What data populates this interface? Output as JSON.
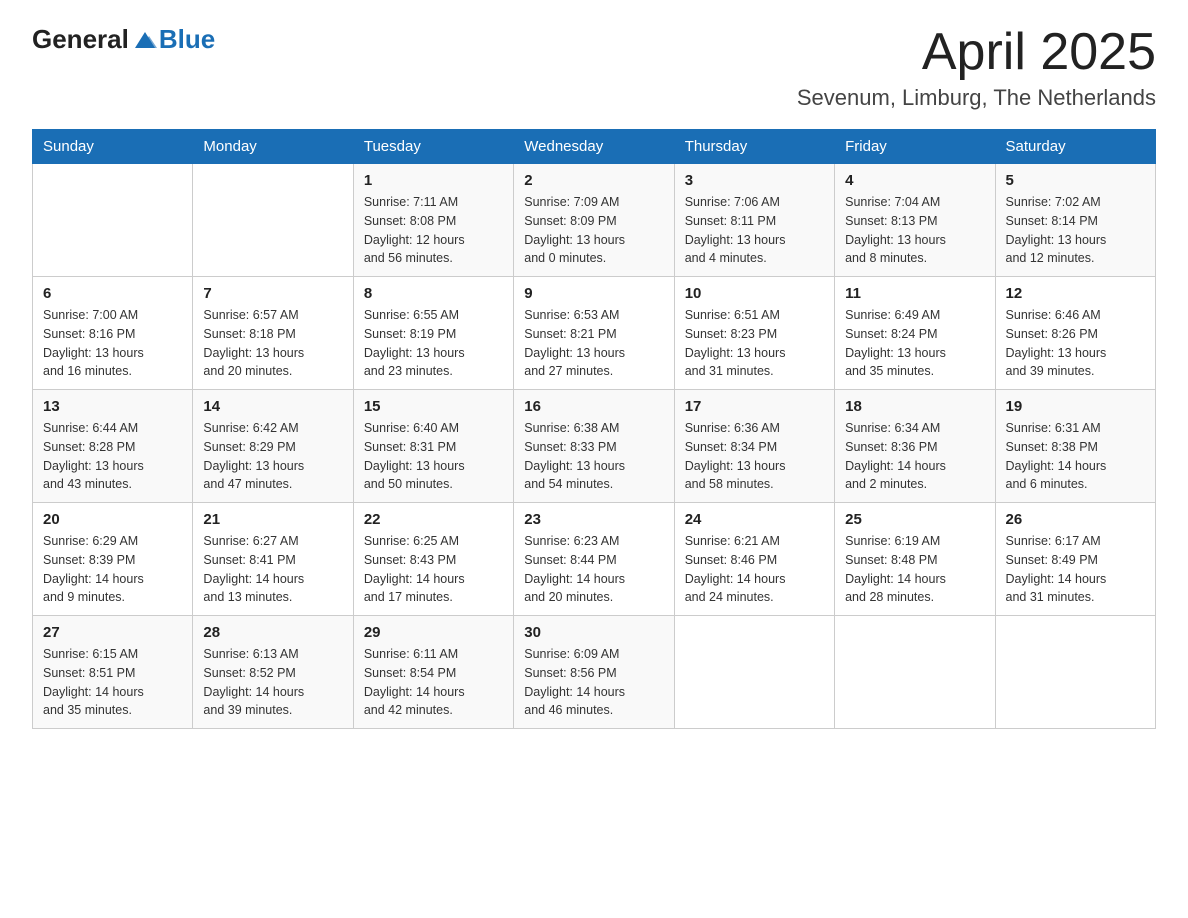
{
  "header": {
    "logo_general": "General",
    "logo_blue": "Blue",
    "title": "April 2025",
    "subtitle": "Sevenum, Limburg, The Netherlands"
  },
  "calendar": {
    "days_of_week": [
      "Sunday",
      "Monday",
      "Tuesday",
      "Wednesday",
      "Thursday",
      "Friday",
      "Saturday"
    ],
    "weeks": [
      [
        {
          "day": "",
          "info": ""
        },
        {
          "day": "",
          "info": ""
        },
        {
          "day": "1",
          "info": "Sunrise: 7:11 AM\nSunset: 8:08 PM\nDaylight: 12 hours\nand 56 minutes."
        },
        {
          "day": "2",
          "info": "Sunrise: 7:09 AM\nSunset: 8:09 PM\nDaylight: 13 hours\nand 0 minutes."
        },
        {
          "day": "3",
          "info": "Sunrise: 7:06 AM\nSunset: 8:11 PM\nDaylight: 13 hours\nand 4 minutes."
        },
        {
          "day": "4",
          "info": "Sunrise: 7:04 AM\nSunset: 8:13 PM\nDaylight: 13 hours\nand 8 minutes."
        },
        {
          "day": "5",
          "info": "Sunrise: 7:02 AM\nSunset: 8:14 PM\nDaylight: 13 hours\nand 12 minutes."
        }
      ],
      [
        {
          "day": "6",
          "info": "Sunrise: 7:00 AM\nSunset: 8:16 PM\nDaylight: 13 hours\nand 16 minutes."
        },
        {
          "day": "7",
          "info": "Sunrise: 6:57 AM\nSunset: 8:18 PM\nDaylight: 13 hours\nand 20 minutes."
        },
        {
          "day": "8",
          "info": "Sunrise: 6:55 AM\nSunset: 8:19 PM\nDaylight: 13 hours\nand 23 minutes."
        },
        {
          "day": "9",
          "info": "Sunrise: 6:53 AM\nSunset: 8:21 PM\nDaylight: 13 hours\nand 27 minutes."
        },
        {
          "day": "10",
          "info": "Sunrise: 6:51 AM\nSunset: 8:23 PM\nDaylight: 13 hours\nand 31 minutes."
        },
        {
          "day": "11",
          "info": "Sunrise: 6:49 AM\nSunset: 8:24 PM\nDaylight: 13 hours\nand 35 minutes."
        },
        {
          "day": "12",
          "info": "Sunrise: 6:46 AM\nSunset: 8:26 PM\nDaylight: 13 hours\nand 39 minutes."
        }
      ],
      [
        {
          "day": "13",
          "info": "Sunrise: 6:44 AM\nSunset: 8:28 PM\nDaylight: 13 hours\nand 43 minutes."
        },
        {
          "day": "14",
          "info": "Sunrise: 6:42 AM\nSunset: 8:29 PM\nDaylight: 13 hours\nand 47 minutes."
        },
        {
          "day": "15",
          "info": "Sunrise: 6:40 AM\nSunset: 8:31 PM\nDaylight: 13 hours\nand 50 minutes."
        },
        {
          "day": "16",
          "info": "Sunrise: 6:38 AM\nSunset: 8:33 PM\nDaylight: 13 hours\nand 54 minutes."
        },
        {
          "day": "17",
          "info": "Sunrise: 6:36 AM\nSunset: 8:34 PM\nDaylight: 13 hours\nand 58 minutes."
        },
        {
          "day": "18",
          "info": "Sunrise: 6:34 AM\nSunset: 8:36 PM\nDaylight: 14 hours\nand 2 minutes."
        },
        {
          "day": "19",
          "info": "Sunrise: 6:31 AM\nSunset: 8:38 PM\nDaylight: 14 hours\nand 6 minutes."
        }
      ],
      [
        {
          "day": "20",
          "info": "Sunrise: 6:29 AM\nSunset: 8:39 PM\nDaylight: 14 hours\nand 9 minutes."
        },
        {
          "day": "21",
          "info": "Sunrise: 6:27 AM\nSunset: 8:41 PM\nDaylight: 14 hours\nand 13 minutes."
        },
        {
          "day": "22",
          "info": "Sunrise: 6:25 AM\nSunset: 8:43 PM\nDaylight: 14 hours\nand 17 minutes."
        },
        {
          "day": "23",
          "info": "Sunrise: 6:23 AM\nSunset: 8:44 PM\nDaylight: 14 hours\nand 20 minutes."
        },
        {
          "day": "24",
          "info": "Sunrise: 6:21 AM\nSunset: 8:46 PM\nDaylight: 14 hours\nand 24 minutes."
        },
        {
          "day": "25",
          "info": "Sunrise: 6:19 AM\nSunset: 8:48 PM\nDaylight: 14 hours\nand 28 minutes."
        },
        {
          "day": "26",
          "info": "Sunrise: 6:17 AM\nSunset: 8:49 PM\nDaylight: 14 hours\nand 31 minutes."
        }
      ],
      [
        {
          "day": "27",
          "info": "Sunrise: 6:15 AM\nSunset: 8:51 PM\nDaylight: 14 hours\nand 35 minutes."
        },
        {
          "day": "28",
          "info": "Sunrise: 6:13 AM\nSunset: 8:52 PM\nDaylight: 14 hours\nand 39 minutes."
        },
        {
          "day": "29",
          "info": "Sunrise: 6:11 AM\nSunset: 8:54 PM\nDaylight: 14 hours\nand 42 minutes."
        },
        {
          "day": "30",
          "info": "Sunrise: 6:09 AM\nSunset: 8:56 PM\nDaylight: 14 hours\nand 46 minutes."
        },
        {
          "day": "",
          "info": ""
        },
        {
          "day": "",
          "info": ""
        },
        {
          "day": "",
          "info": ""
        }
      ]
    ]
  }
}
